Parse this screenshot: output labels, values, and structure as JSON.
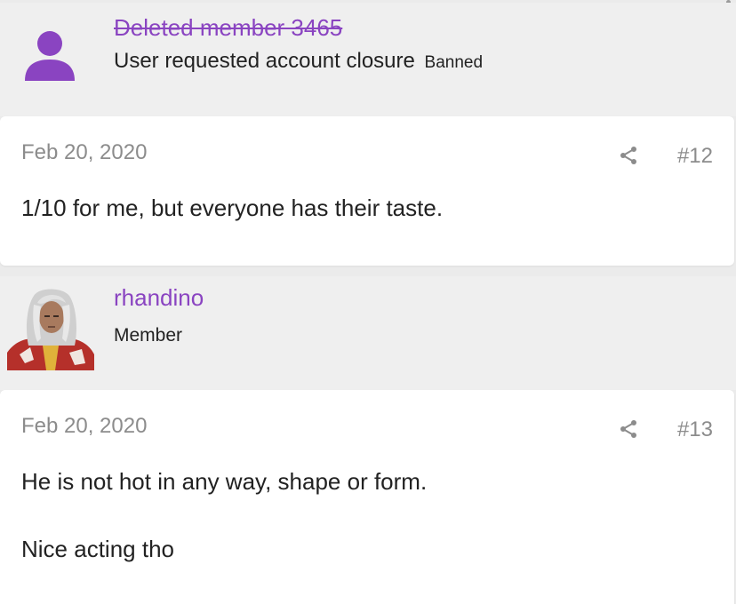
{
  "posts": [
    {
      "author": {
        "name": "Deleted member 3465",
        "title": "User requested account closure",
        "banner": "Banned",
        "avatar": "generic-person-icon"
      },
      "date": "Feb 20, 2020",
      "number": "#12",
      "lines": [
        "1/10 for me, but everyone has their taste."
      ]
    },
    {
      "author": {
        "name": "rhandino",
        "title": "Member",
        "avatar": "white-haired-character-avatar"
      },
      "date": "Feb 20, 2020",
      "number": "#13",
      "lines": [
        "He is not hot in any way, shape or form.",
        "Nice acting tho"
      ]
    }
  ],
  "colors": {
    "username": "#8a44c1",
    "avatar_generic": "#8a44c1",
    "meta": "#8c8c8c",
    "page_bg": "#ebebeb"
  }
}
